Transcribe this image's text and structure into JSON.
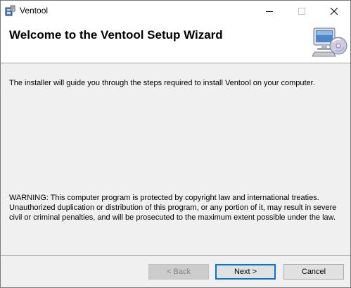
{
  "window": {
    "title": "Ventool",
    "icon": "installer-package-icon",
    "controls": {
      "minimize_glyph": "—",
      "maximize_glyph": "☐",
      "close_glyph": "✕"
    }
  },
  "header": {
    "title": "Welcome to the Ventool Setup Wizard",
    "icon": "computer-cd-icon"
  },
  "body": {
    "intro": "The installer will guide you through the steps required to install Ventool on your computer.",
    "warning": "WARNING: This computer program is protected by copyright law and international treaties. Unauthorized duplication or distribution of this program, or any portion of it, may result in severe civil or criminal penalties, and will be prosecuted to the maximum extent possible under the law."
  },
  "buttons": {
    "back": {
      "label": "< Back",
      "enabled": false
    },
    "next": {
      "label": "Next >",
      "enabled": true,
      "default": true
    },
    "cancel": {
      "label": "Cancel",
      "enabled": true
    }
  },
  "colors": {
    "accent": "#0078d7",
    "window_bg": "#f0f0f0",
    "header_bg": "#ffffff"
  }
}
